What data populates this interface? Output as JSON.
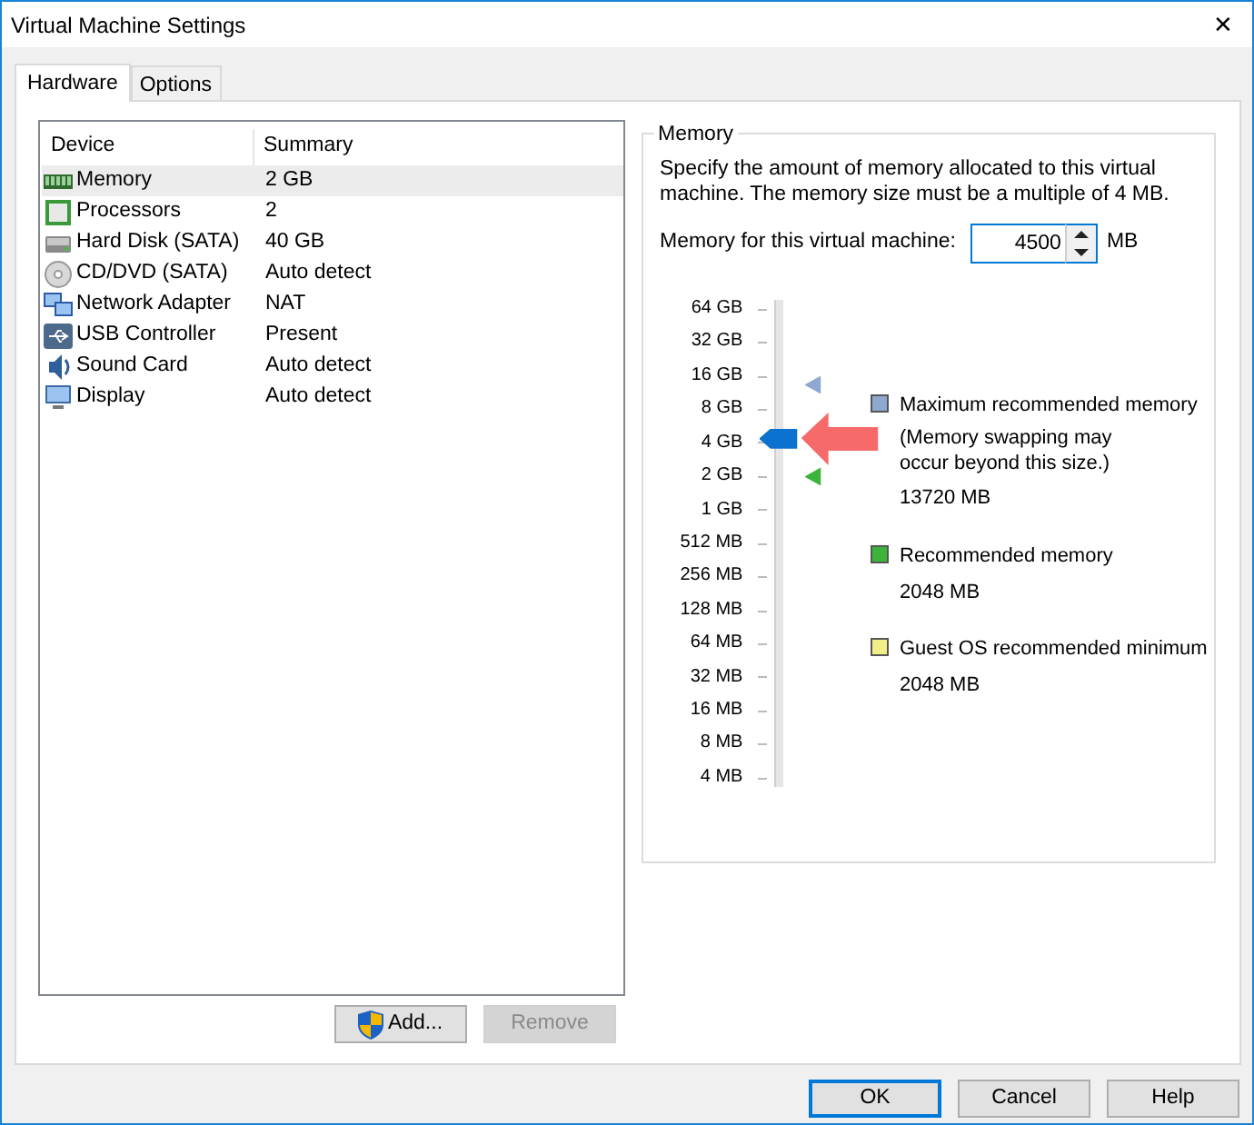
{
  "window": {
    "title": "Virtual Machine Settings",
    "close": "✕"
  },
  "tabs": [
    {
      "label": "Hardware",
      "selected": true
    },
    {
      "label": "Options",
      "selected": false
    }
  ],
  "devices": {
    "columns": [
      "Device",
      "Summary"
    ],
    "rows": [
      {
        "kind": "memory",
        "device": "Memory",
        "summary": "2 GB",
        "selected": true
      },
      {
        "kind": "cpu",
        "device": "Processors",
        "summary": "2",
        "selected": false
      },
      {
        "kind": "disk",
        "device": "Hard Disk (SATA)",
        "summary": "40 GB",
        "selected": false
      },
      {
        "kind": "cdrom",
        "device": "CD/DVD (SATA)",
        "summary": "Auto detect",
        "selected": false
      },
      {
        "kind": "network",
        "device": "Network Adapter",
        "summary": "NAT",
        "selected": false
      },
      {
        "kind": "usb",
        "device": "USB Controller",
        "summary": "Present",
        "selected": false
      },
      {
        "kind": "sound",
        "device": "Sound Card",
        "summary": "Auto detect",
        "selected": false
      },
      {
        "kind": "display",
        "device": "Display",
        "summary": "Auto detect",
        "selected": false
      }
    ]
  },
  "list_buttons": [
    {
      "label": "Add...",
      "shield": true,
      "disabled": false
    },
    {
      "label": "Remove",
      "shield": false,
      "disabled": true
    }
  ],
  "memory": {
    "title": "Memory",
    "description": "Specify the amount of memory allocated to this virtual machine. The memory size must be a multiple of 4 MB.",
    "field_label": "Memory for this virtual machine:",
    "value": "4500",
    "unit": "MB",
    "scale": [
      "64 GB",
      "32 GB",
      "16 GB",
      "8 GB",
      "4 GB",
      "2 GB",
      "1 GB",
      "512 MB",
      "256 MB",
      "128 MB",
      "64 MB",
      "32 MB",
      "16 MB",
      "8 MB",
      "4 MB"
    ],
    "level": 0.724,
    "markers": [
      {
        "color": "#8fa8d0",
        "level": 0.839
      },
      {
        "color": "#3cb43c",
        "level": 0.643
      }
    ],
    "legend": [
      {
        "color": "#8fa8d0",
        "label": "Maximum recommended memory",
        "note": "(Memory swapping may occur beyond this size.)",
        "value": "13720 MB"
      },
      {
        "color": "#3cb43c",
        "label": "Recommended memory",
        "value": "2048 MB"
      },
      {
        "color": "#f2ee8a",
        "label": "Guest OS recommended minimum",
        "value": "2048 MB"
      }
    ]
  },
  "footer_buttons": [
    {
      "label": "OK",
      "default": true
    },
    {
      "label": "Cancel",
      "default": false
    },
    {
      "label": "Help",
      "default": false
    }
  ]
}
